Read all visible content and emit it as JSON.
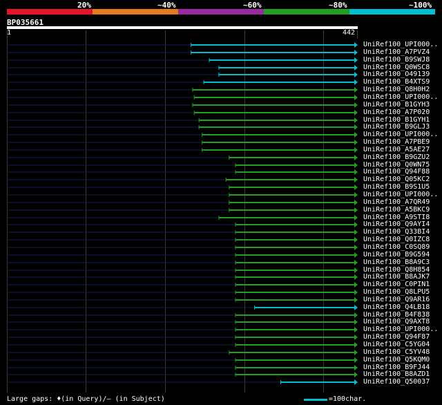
{
  "legend": {
    "labels": [
      "20%",
      "~40%",
      "~60%",
      "~80%",
      "~100%"
    ],
    "colors": [
      "#e8122d",
      "#e87a1e",
      "#9a2aa0",
      "#1fa01f",
      "#00bfd0"
    ]
  },
  "query": {
    "name": "BP035661",
    "start_label": "1",
    "end_label": "442",
    "length": 442
  },
  "footer": {
    "gaps_text": "Large gaps: ♦(in Query)/– (in Subject)",
    "scale_text": "=100char."
  },
  "hits": [
    {
      "label": "UniRef100_UPI000..",
      "start": 232,
      "end": 442,
      "band": 4
    },
    {
      "label": "UniRef100_A7PVZ4",
      "start": 232,
      "end": 442,
      "band": 4
    },
    {
      "label": "UniRef100_B9SWJ8",
      "start": 255,
      "end": 442,
      "band": 4
    },
    {
      "label": "UniRef100_Q0WSC8",
      "start": 267,
      "end": 442,
      "band": 4
    },
    {
      "label": "UniRef100_O49139",
      "start": 267,
      "end": 442,
      "band": 4
    },
    {
      "label": "UniRef100_B4XTS9",
      "start": 248,
      "end": 442,
      "band": 4
    },
    {
      "label": "UniRef100_Q8H0H2",
      "start": 234,
      "end": 442,
      "band": 3
    },
    {
      "label": "UniRef100_UPI000..",
      "start": 236,
      "end": 442,
      "band": 3
    },
    {
      "label": "UniRef100_B1GYH3",
      "start": 234,
      "end": 442,
      "band": 3
    },
    {
      "label": "UniRef100_A7P020",
      "start": 236,
      "end": 442,
      "band": 3
    },
    {
      "label": "UniRef100_B1GYH1",
      "start": 242,
      "end": 442,
      "band": 3
    },
    {
      "label": "UniRef100_B9GLJ3",
      "start": 242,
      "end": 442,
      "band": 3
    },
    {
      "label": "UniRef100_UPI000..",
      "start": 246,
      "end": 442,
      "band": 3
    },
    {
      "label": "UniRef100_A7PBE9",
      "start": 246,
      "end": 442,
      "band": 3
    },
    {
      "label": "UniRef100_A5AE27",
      "start": 246,
      "end": 442,
      "band": 3
    },
    {
      "label": "UniRef100_B9GZU2",
      "start": 280,
      "end": 442,
      "band": 3
    },
    {
      "label": "UniRef100_Q0WN75",
      "start": 288,
      "end": 442,
      "band": 3
    },
    {
      "label": "UniRef100_Q94F88",
      "start": 288,
      "end": 442,
      "band": 3
    },
    {
      "label": "UniRef100_Q05KC2",
      "start": 276,
      "end": 442,
      "band": 3
    },
    {
      "label": "UniRef100_B9S1U5",
      "start": 280,
      "end": 442,
      "band": 3
    },
    {
      "label": "UniRef100_UPI000..",
      "start": 280,
      "end": 442,
      "band": 3
    },
    {
      "label": "UniRef100_A7QR49",
      "start": 280,
      "end": 442,
      "band": 3
    },
    {
      "label": "UniRef100_A5BKC9",
      "start": 280,
      "end": 442,
      "band": 3
    },
    {
      "label": "UniRef100_A9STI8",
      "start": 267,
      "end": 442,
      "band": 3
    },
    {
      "label": "UniRef100_Q9AYI4",
      "start": 288,
      "end": 442,
      "band": 3
    },
    {
      "label": "UniRef100_Q33BI4",
      "start": 288,
      "end": 442,
      "band": 3
    },
    {
      "label": "UniRef100_Q0IZC8",
      "start": 288,
      "end": 442,
      "band": 3
    },
    {
      "label": "UniRef100_C0SQ89",
      "start": 288,
      "end": 442,
      "band": 3
    },
    {
      "label": "UniRef100_B9G594",
      "start": 288,
      "end": 442,
      "band": 3
    },
    {
      "label": "UniRef100_B8A9C3",
      "start": 288,
      "end": 442,
      "band": 3
    },
    {
      "label": "UniRef100_Q8H854",
      "start": 288,
      "end": 442,
      "band": 3
    },
    {
      "label": "UniRef100_B8AJK7",
      "start": 288,
      "end": 442,
      "band": 3
    },
    {
      "label": "UniRef100_C0PIN1",
      "start": 288,
      "end": 442,
      "band": 3
    },
    {
      "label": "UniRef100_Q8LPU5",
      "start": 288,
      "end": 442,
      "band": 3
    },
    {
      "label": "UniRef100_Q9AR16",
      "start": 288,
      "end": 442,
      "band": 3
    },
    {
      "label": "UniRef100_Q4LB18",
      "start": 312,
      "end": 442,
      "band": 4
    },
    {
      "label": "UniRef100_B4F838",
      "start": 288,
      "end": 442,
      "band": 3
    },
    {
      "label": "UniRef100_Q9AXT8",
      "start": 288,
      "end": 442,
      "band": 3
    },
    {
      "label": "UniRef100_UPI000..",
      "start": 288,
      "end": 442,
      "band": 3
    },
    {
      "label": "UniRef100_Q94F87",
      "start": 288,
      "end": 442,
      "band": 3
    },
    {
      "label": "UniRef100_C5YG04",
      "start": 288,
      "end": 442,
      "band": 3
    },
    {
      "label": "UniRef100_C5YV48",
      "start": 280,
      "end": 442,
      "band": 3
    },
    {
      "label": "UniRef100_Q5KQM0",
      "start": 288,
      "end": 442,
      "band": 3
    },
    {
      "label": "UniRef100_B9FJ44",
      "start": 288,
      "end": 442,
      "band": 3
    },
    {
      "label": "UniRef100_B8AZD1",
      "start": 288,
      "end": 442,
      "band": 3
    },
    {
      "label": "UniRef100_Q50037",
      "start": 345,
      "end": 442,
      "band": 4
    }
  ]
}
